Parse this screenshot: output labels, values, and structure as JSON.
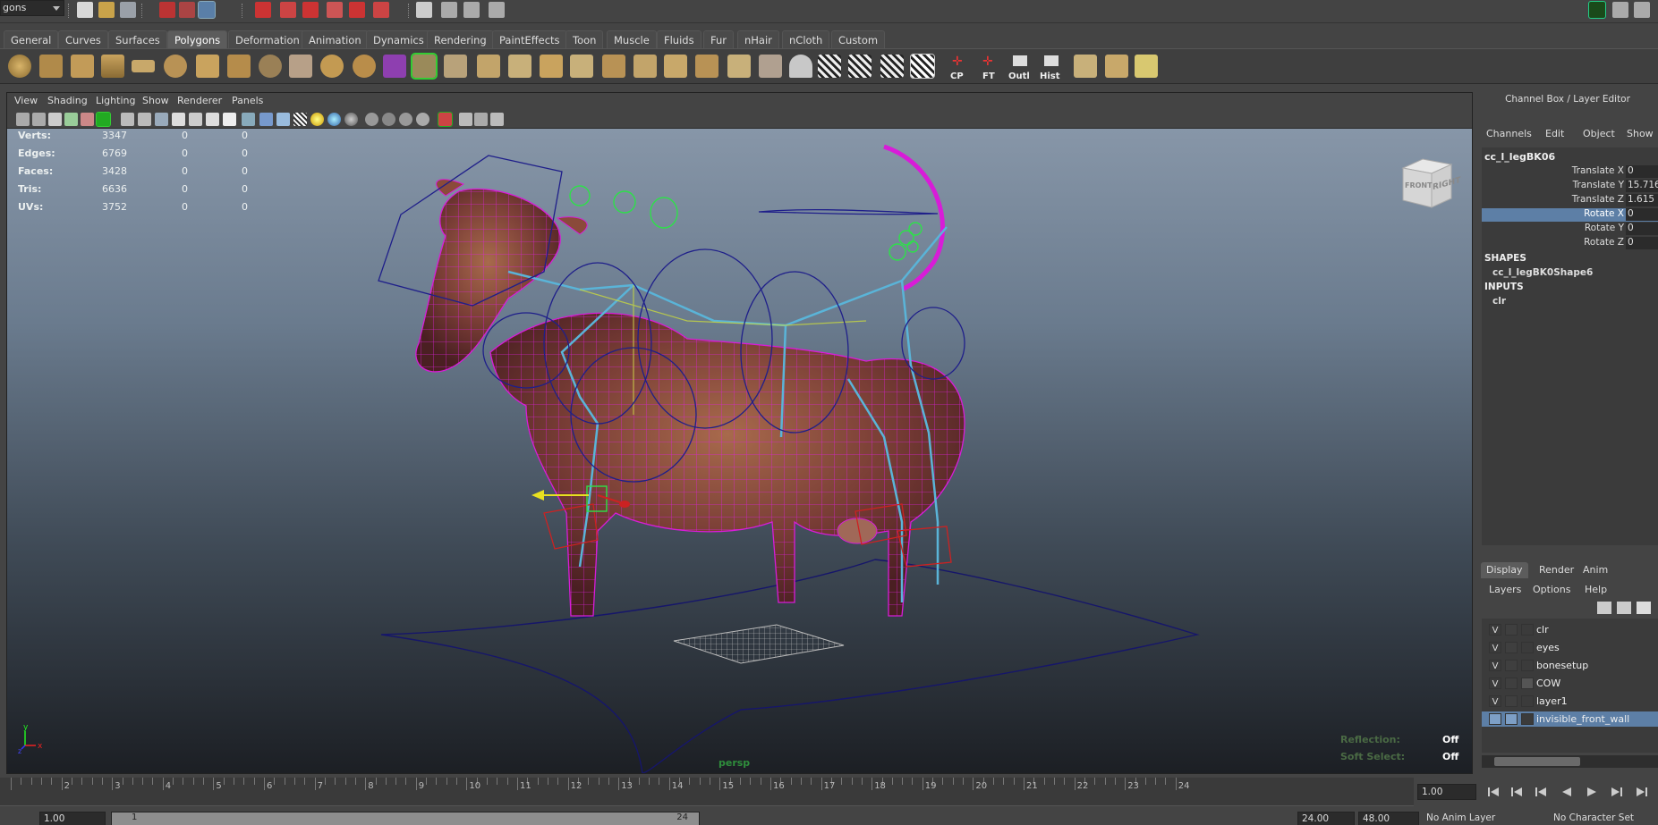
{
  "status_line": {
    "mode": "gons"
  },
  "shelf_tabs": [
    "General",
    "Curves",
    "Surfaces",
    "Polygons",
    "Deformation",
    "Animation",
    "Dynamics",
    "Rendering",
    "PaintEffects",
    "Toon",
    "Muscle",
    "Fluids",
    "Fur",
    "nHair",
    "nCloth",
    "Custom"
  ],
  "active_shelf_tab": "Polygons",
  "shelf_buttons": {
    "cp": "CP",
    "ft": "FT",
    "outl": "Outl",
    "hist": "Hist"
  },
  "panel_menu": [
    "View",
    "Shading",
    "Lighting",
    "Show",
    "Renderer",
    "Panels"
  ],
  "hud": {
    "rows": [
      {
        "label": "Verts:",
        "v1": "3347",
        "v2": "0",
        "v3": "0"
      },
      {
        "label": "Edges:",
        "v1": "6769",
        "v2": "0",
        "v3": "0"
      },
      {
        "label": "Faces:",
        "v1": "3428",
        "v2": "0",
        "v3": "0"
      },
      {
        "label": "Tris:",
        "v1": "6636",
        "v2": "0",
        "v3": "0"
      },
      {
        "label": "UVs:",
        "v1": "3752",
        "v2": "0",
        "v3": "0"
      }
    ],
    "camera": "persp",
    "reflection_label": "Reflection:",
    "reflection_value": "Off",
    "soft_select_label": "Soft Select:",
    "soft_select_value": "Off"
  },
  "viewcube": {
    "front": "FRONT",
    "right": "RIGHT"
  },
  "channel_box": {
    "title": "Channel Box / Layer Editor",
    "menu": [
      "Channels",
      "Edit",
      "Object",
      "Show"
    ],
    "node": "cc_l_legBK06",
    "attributes": [
      {
        "name": "Translate X",
        "value": "0"
      },
      {
        "name": "Translate Y",
        "value": "15.716"
      },
      {
        "name": "Translate Z",
        "value": "1.615"
      },
      {
        "name": "Rotate X",
        "value": "0"
      },
      {
        "name": "Rotate Y",
        "value": "0"
      },
      {
        "name": "Rotate Z",
        "value": "0"
      }
    ],
    "selected_attribute": "Rotate X",
    "shapes_label": "SHAPES",
    "shape_node": "cc_l_legBK0Shape6",
    "inputs_label": "INPUTS",
    "input_node": "clr"
  },
  "layer_editor": {
    "tabs": [
      "Display",
      "Render",
      "Anim"
    ],
    "active_tab": "Display",
    "menu": [
      "Layers",
      "Options",
      "Help"
    ],
    "layers": [
      {
        "v": "V",
        "name": "clr"
      },
      {
        "v": "V",
        "name": "eyes"
      },
      {
        "v": "V",
        "name": "bonesetup"
      },
      {
        "v": "V",
        "name": "COW"
      },
      {
        "v": "V",
        "name": "layer1"
      },
      {
        "v": "",
        "name": "invisible_front_wall"
      }
    ],
    "selected_layer": "invisible_front_wall"
  },
  "time_slider": {
    "frame_labels": [
      "2",
      "3",
      "4",
      "5",
      "6",
      "7",
      "8",
      "9",
      "10",
      "11",
      "12",
      "13",
      "14",
      "15",
      "16",
      "17",
      "18",
      "19",
      "20",
      "21",
      "22",
      "23",
      "24"
    ],
    "current_frame": "1.00"
  },
  "range_slider": {
    "start": "1.00",
    "range_start": "1",
    "range_end": "24",
    "end": "24.00",
    "anim_end": "48.00",
    "anim_layer": "No Anim Layer",
    "character_set": "No Character Set"
  },
  "colors": {
    "ui_bg": "#444444",
    "selection": "#5d7fa6",
    "wireframe": "#e020e0",
    "joint": "#5ab4d8",
    "controller": "#2a2a9a",
    "green_ctrl": "#2ee04a"
  }
}
